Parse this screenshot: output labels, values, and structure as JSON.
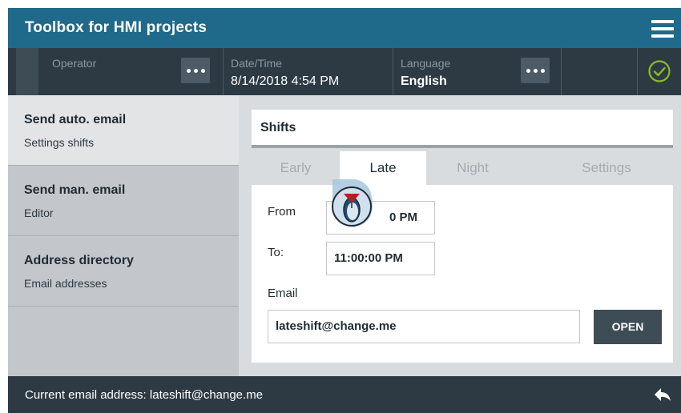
{
  "app": {
    "title": "Toolbox for HMI projects"
  },
  "header": {
    "menu_icon": "hamburger-menu-icon"
  },
  "infobar": {
    "operator_label": "Operator",
    "datetime_label": "Date/Time",
    "datetime_value": "8/14/2018 4:54 PM",
    "language_label": "Language",
    "language_value": "English",
    "status_icon": "checkmark-circle-icon",
    "status_color": "#8dbb23"
  },
  "sidebar": {
    "items": [
      {
        "title": "Send auto. email",
        "subtitle": "Settings shifts",
        "active": true
      },
      {
        "title": "Send man. email",
        "subtitle": "Editor",
        "active": false
      },
      {
        "title": "Address directory",
        "subtitle": "Email addresses",
        "active": false
      }
    ]
  },
  "panel": {
    "title": "Shifts",
    "tabs": [
      {
        "label": "Early",
        "active": false
      },
      {
        "label": "Late",
        "active": true
      },
      {
        "label": "Night",
        "active": false
      },
      {
        "label": "Settings",
        "active": false
      }
    ],
    "from_label": "From",
    "from_value_visible": "0 PM",
    "to_label": "To:",
    "to_value": "11:00:00 PM",
    "email_label": "Email",
    "email_value": "lateshift@change.me",
    "open_button": "OPEN"
  },
  "footer": {
    "message": "Current email address: lateshift@change.me",
    "back_icon": "back-arrow-icon"
  },
  "colors": {
    "titlebar": "#1f6a8a",
    "infobar": "#2d3a44",
    "accent_cursor": "#b32020"
  }
}
